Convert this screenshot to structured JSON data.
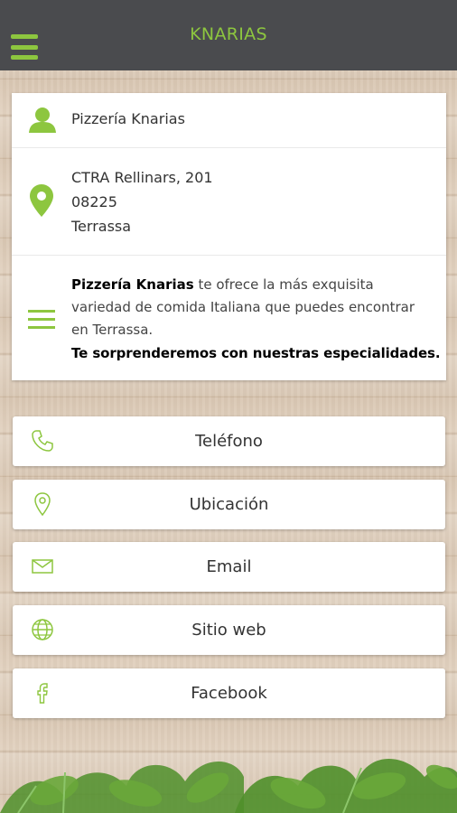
{
  "header": {
    "title": "KNARIAS"
  },
  "info": {
    "name": "Pizzería Knarias",
    "address": {
      "street": "CTRA Rellinars, 201",
      "postal_code": "08225",
      "city": "Terrassa"
    },
    "description": {
      "bold_name": "Pizzería Knarias",
      "text": " te ofrece la más exquisita variedad de comida Italiana que puedes encontrar en Terrassa.",
      "tagline": "Te sorprenderemos con nuestras especialidades."
    }
  },
  "actions": {
    "phone": "Teléfono",
    "location": "Ubicación",
    "email": "Email",
    "website": "Sitio web",
    "facebook": "Facebook"
  },
  "colors": {
    "accent": "#8dc63f",
    "topbar": "#4a4b4e"
  },
  "icons": [
    "menu-icon",
    "person-icon",
    "map-pin-icon",
    "lines-icon",
    "phone-icon",
    "location-icon",
    "mail-icon",
    "globe-icon",
    "facebook-icon"
  ]
}
